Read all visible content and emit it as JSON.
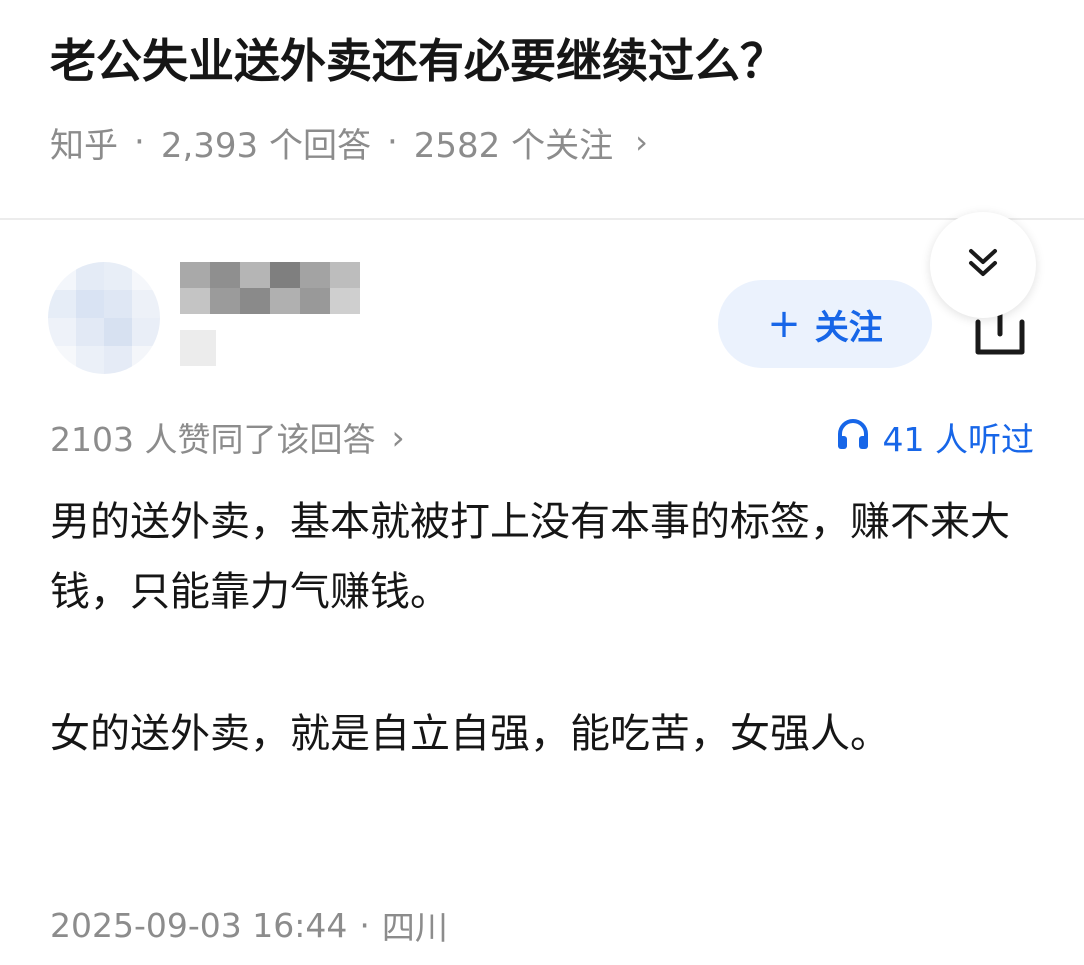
{
  "question": {
    "title": "老公失业送外卖还有必要继续过么？",
    "source": "知乎",
    "answer_count": "2,393 个回答",
    "follower_count": "2582 个关注",
    "separator": "·",
    "chevron": "›"
  },
  "author": {
    "follow_label": "关注",
    "follow_plus": "+",
    "avatar_color": "#dce6f5"
  },
  "answer": {
    "likes": "2103 人赞同了该回答",
    "listens": "41 人听过",
    "paragraphs": [
      "男的送外卖，基本就被打上没有本事的标签，赚不来大钱，只能靠力气赚钱。",
      "女的送外卖，就是自立自强，能吃苦，女强人。"
    ],
    "date": "2025-09-03 16:44",
    "location": "四川"
  },
  "icons": {
    "share": "share-icon",
    "collapse": "double-chevron-down-icon",
    "headphones": "headphones-icon"
  },
  "colors": {
    "accent": "#1766e8",
    "follow_bg": "#ebf2fd",
    "muted_text": "#8c8c8c",
    "title_text": "#161616"
  }
}
